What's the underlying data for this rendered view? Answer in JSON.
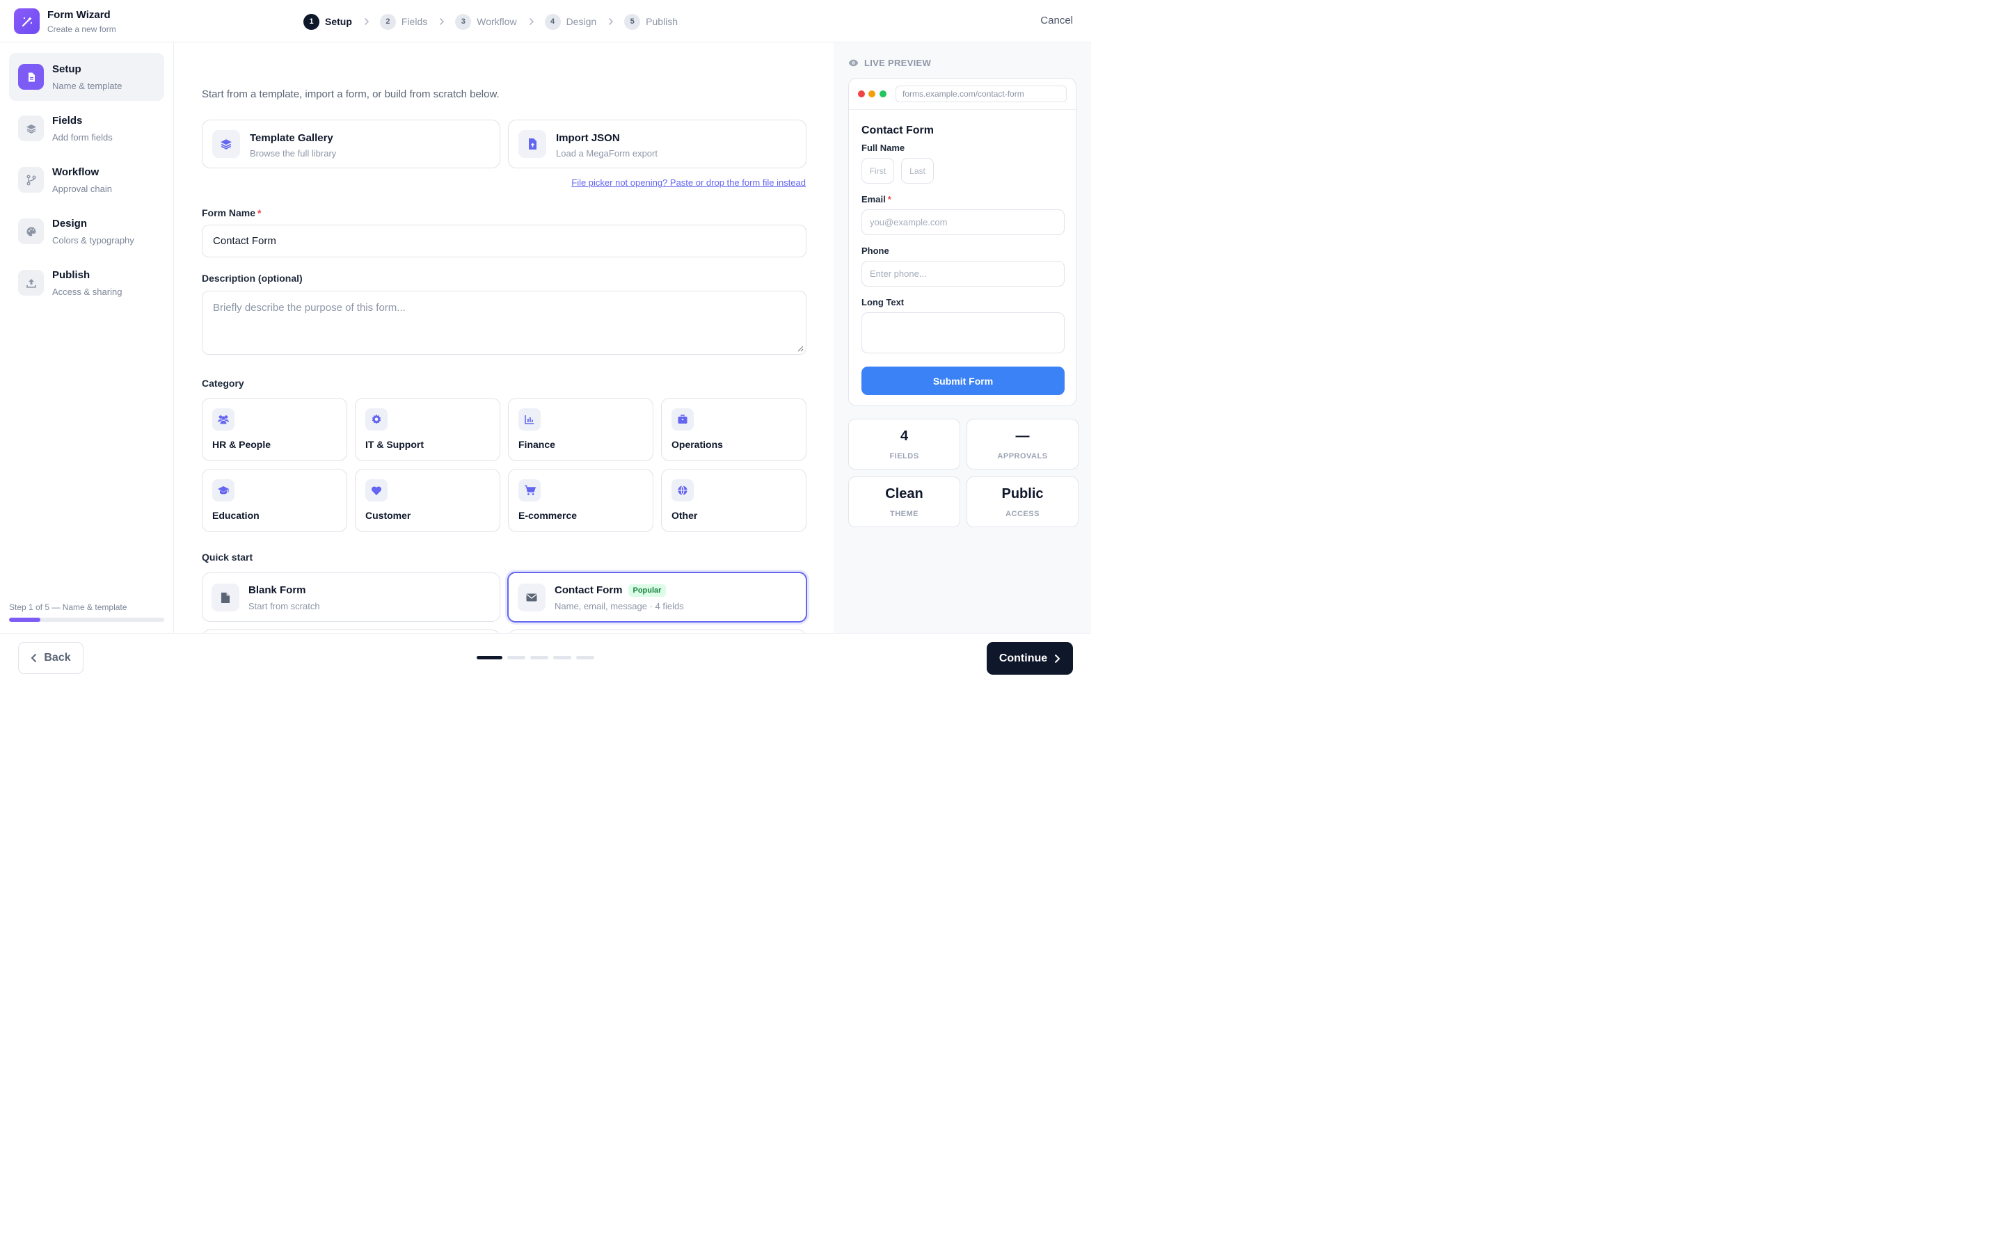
{
  "header": {
    "title": "Form Wizard",
    "subtitle": "Create a new form",
    "cancel_label": "Cancel",
    "steps": [
      {
        "num": "1",
        "label": "Setup"
      },
      {
        "num": "2",
        "label": "Fields"
      },
      {
        "num": "3",
        "label": "Workflow"
      },
      {
        "num": "4",
        "label": "Design"
      },
      {
        "num": "5",
        "label": "Publish"
      }
    ]
  },
  "sidebar": {
    "items": [
      {
        "title": "Setup",
        "sub": "Name & template",
        "icon": "document-icon"
      },
      {
        "title": "Fields",
        "sub": "Add form fields",
        "icon": "layers-icon"
      },
      {
        "title": "Workflow",
        "sub": "Approval chain",
        "icon": "branch-icon"
      },
      {
        "title": "Design",
        "sub": "Colors & typography",
        "icon": "palette-icon"
      },
      {
        "title": "Publish",
        "sub": "Access & sharing",
        "icon": "upload-icon"
      }
    ],
    "progress_label": "Step 1 of 5 — Name & template",
    "progress_value": 0.2
  },
  "main": {
    "intro": "Start from a template, import a form, or build from scratch below.",
    "template_gallery": {
      "title": "Template Gallery",
      "sub": "Browse the full library"
    },
    "import_json": {
      "title": "Import JSON",
      "sub": "Load a MegaForm export"
    },
    "file_link": "File picker not opening? Paste or drop the form file instead",
    "form_name_label": "Form Name",
    "required_mark": "*",
    "form_name_value": "Contact Form",
    "description_label": "Description (optional)",
    "description_placeholder": "Briefly describe the purpose of this form...",
    "category_label": "Category",
    "categories": [
      {
        "label": "HR & People",
        "icon": "people-icon"
      },
      {
        "label": "IT & Support",
        "icon": "gear-icon"
      },
      {
        "label": "Finance",
        "icon": "chart-icon"
      },
      {
        "label": "Operations",
        "icon": "briefcase-icon"
      },
      {
        "label": "Education",
        "icon": "graduation-cap-icon"
      },
      {
        "label": "Customer",
        "icon": "heart-icon"
      },
      {
        "label": "E-commerce",
        "icon": "cart-icon"
      },
      {
        "label": "Other",
        "icon": "globe-icon"
      }
    ],
    "quick_start_label": "Quick start",
    "quick_start": [
      {
        "title": "Blank Form",
        "sub": "Start from scratch",
        "icon": "file-icon"
      },
      {
        "title": "Contact Form",
        "sub": "Name, email, message · 4 fields",
        "badge": "Popular",
        "icon": "envelope-icon"
      }
    ]
  },
  "preview": {
    "label": "LIVE PREVIEW",
    "url": "forms.example.com/contact-form",
    "form_title": "Contact Form",
    "full_name_label": "Full Name",
    "first_placeholder": "First",
    "last_placeholder": "Last",
    "email_label": "Email",
    "email_placeholder": "you@example.com",
    "phone_label": "Phone",
    "phone_placeholder": "Enter phone...",
    "long_text_label": "Long Text",
    "submit_label": "Submit Form",
    "stats": [
      {
        "value": "4",
        "label": "FIELDS"
      },
      {
        "value": "—",
        "label": "APPROVALS"
      },
      {
        "value": "Clean",
        "label": "THEME"
      },
      {
        "value": "Public",
        "label": "ACCESS"
      }
    ]
  },
  "footer": {
    "back_label": "Back",
    "continue_label": "Continue"
  },
  "colors": {
    "accent": "#7c5cf5",
    "primary_dark": "#0f172a",
    "submit_blue": "#3b82f6",
    "indigo": "#6366f1"
  }
}
